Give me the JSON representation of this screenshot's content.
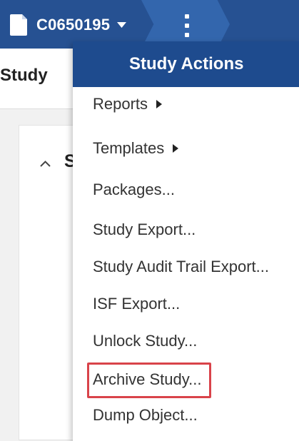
{
  "header": {
    "study_id": "C0650195",
    "study_icon": "document-icon",
    "dropdown_icon": "caret-down-icon",
    "more_icon": "vertical-ellipsis-icon",
    "color_bar": "#265192",
    "color_chevron": "#3366ad"
  },
  "page": {
    "subheader_title": "Study",
    "section_letter": "S"
  },
  "menu": {
    "title": "Study Actions",
    "header_color": "#1e4b8e",
    "items": [
      {
        "label": "Reports",
        "has_submenu": true
      },
      {
        "label": "Templates",
        "has_submenu": true
      },
      {
        "label": "Packages..."
      },
      {
        "label": "Study Export..."
      },
      {
        "label": "Study Audit Trail Export..."
      },
      {
        "label": "ISF Export..."
      },
      {
        "label": "Unlock Study..."
      },
      {
        "label": "Archive Study...",
        "highlighted": true,
        "highlight_color": "#d9434a"
      },
      {
        "label": "Dump Object..."
      }
    ]
  }
}
